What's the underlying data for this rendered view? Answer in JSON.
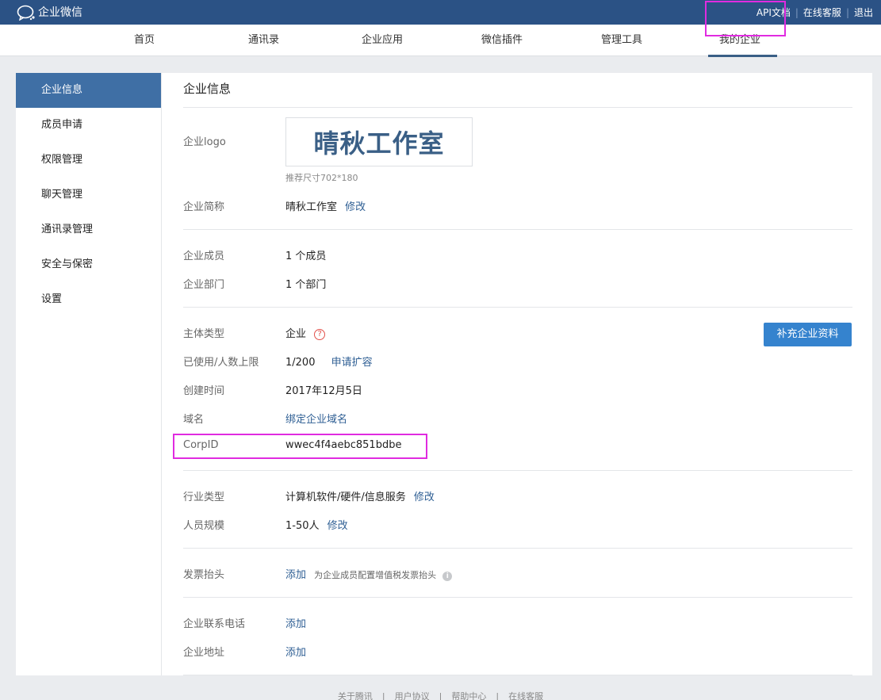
{
  "header": {
    "brand": "企业微信",
    "links": [
      "API文档",
      "在线客服",
      "退出"
    ]
  },
  "nav": {
    "items": [
      "首页",
      "通讯录",
      "企业应用",
      "微信插件",
      "管理工具",
      "我的企业"
    ],
    "active": "我的企业"
  },
  "sidebar": {
    "items": [
      "企业信息",
      "成员申请",
      "权限管理",
      "聊天管理",
      "通讯录管理",
      "安全与保密",
      "设置"
    ],
    "active": "企业信息"
  },
  "content": {
    "title": "企业信息",
    "logo": {
      "label": "企业logo",
      "text": "晴秋工作室",
      "hint": "推荐尺寸702*180"
    },
    "short_name": {
      "label": "企业简称",
      "value": "晴秋工作室",
      "action": "修改"
    },
    "members": {
      "label": "企业成员",
      "value": "1 个成员"
    },
    "departments": {
      "label": "企业部门",
      "value": "1 个部门"
    },
    "entity_type": {
      "label": "主体类型",
      "value": "企业",
      "help": "?"
    },
    "usage": {
      "label": "已使用/人数上限",
      "value": "1/200",
      "action": "申请扩容"
    },
    "created": {
      "label": "创建时间",
      "value": "2017年12月5日"
    },
    "domain": {
      "label": "域名",
      "action": "绑定企业域名"
    },
    "corpid": {
      "label": "CorpID",
      "value": "wwec4f4aebc851bdbe"
    },
    "industry": {
      "label": "行业类型",
      "value": "计算机软件/硬件/信息服务",
      "action": "修改"
    },
    "scale": {
      "label": "人员规模",
      "value": "1-50人",
      "action": "修改"
    },
    "invoice": {
      "label": "发票抬头",
      "action": "添加",
      "note": "为企业成员配置增值税发票抬头",
      "info": "i"
    },
    "phone": {
      "label": "企业联系电话",
      "action": "添加"
    },
    "address": {
      "label": "企业地址",
      "action": "添加"
    },
    "supplement_button": "补充企业资料"
  },
  "footer": {
    "links": [
      "关于腾讯",
      "用户协议",
      "帮助中心",
      "在线客服"
    ]
  },
  "colors": {
    "topbar": "#2b5285",
    "active_sidebar": "#3f6fa5",
    "link": "#2f5f94",
    "button": "#3583ce",
    "highlight": "#e02be0"
  }
}
